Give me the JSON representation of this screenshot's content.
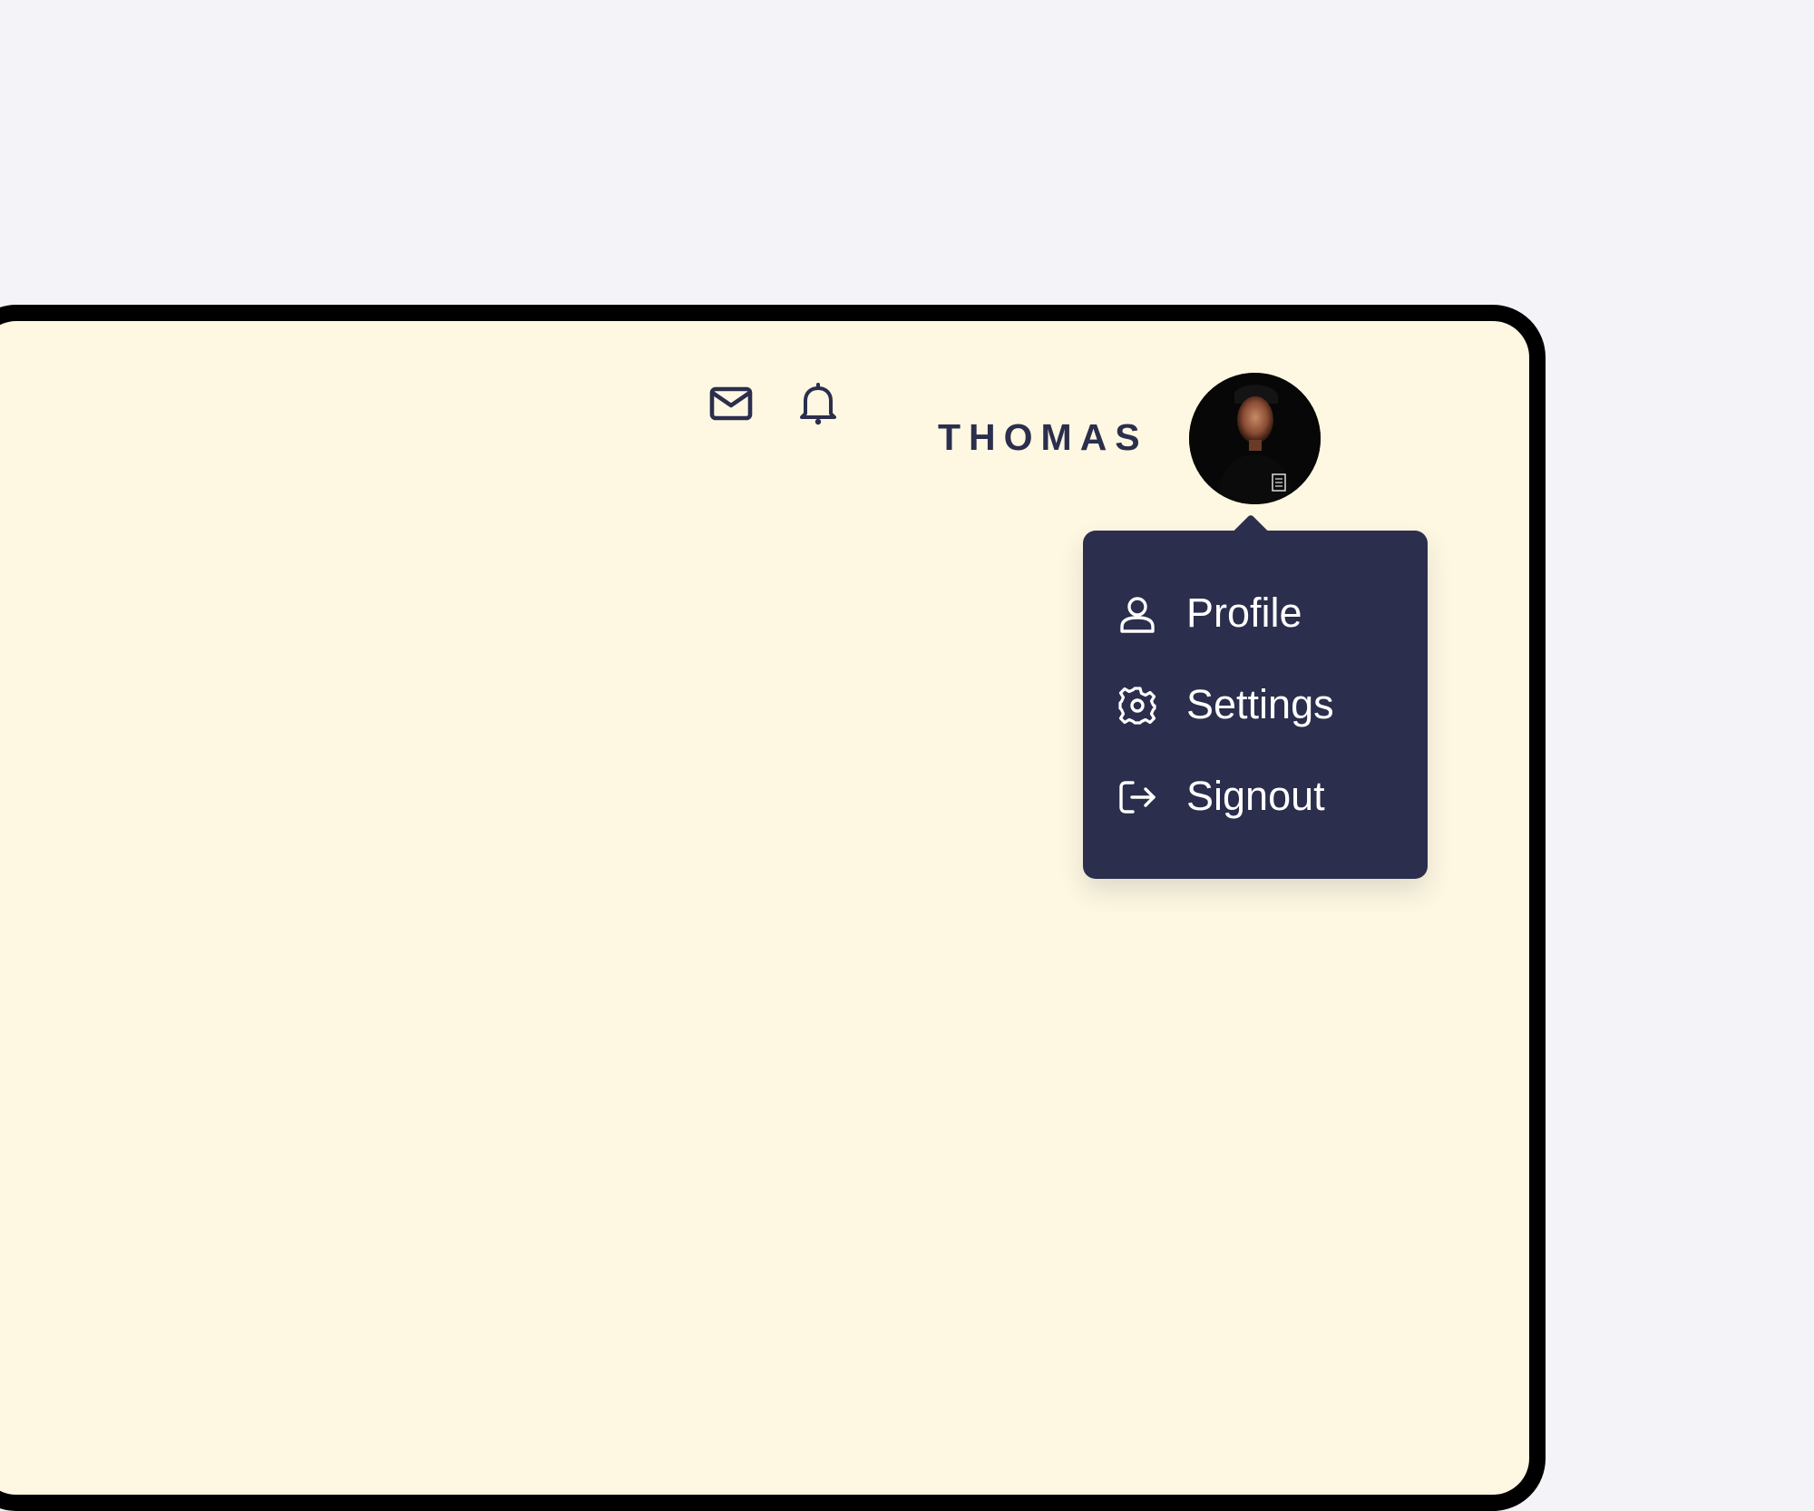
{
  "header": {
    "username": "THOMAS",
    "icons": {
      "mail": "mail-icon",
      "notifications": "bell-icon",
      "avatar": "user-avatar-photo"
    }
  },
  "user_menu": {
    "items": [
      {
        "label": "Profile",
        "icon": "user-icon"
      },
      {
        "label": "Settings",
        "icon": "gear-icon"
      },
      {
        "label": "Signout",
        "icon": "signout-icon"
      }
    ]
  },
  "colors": {
    "page_background": "#f3f3f8",
    "content_background": "#fef8e2",
    "frame_border": "#000000",
    "menu_background": "#2b2e4c",
    "menu_text": "#ffffff",
    "header_text": "#2b2e4c"
  }
}
